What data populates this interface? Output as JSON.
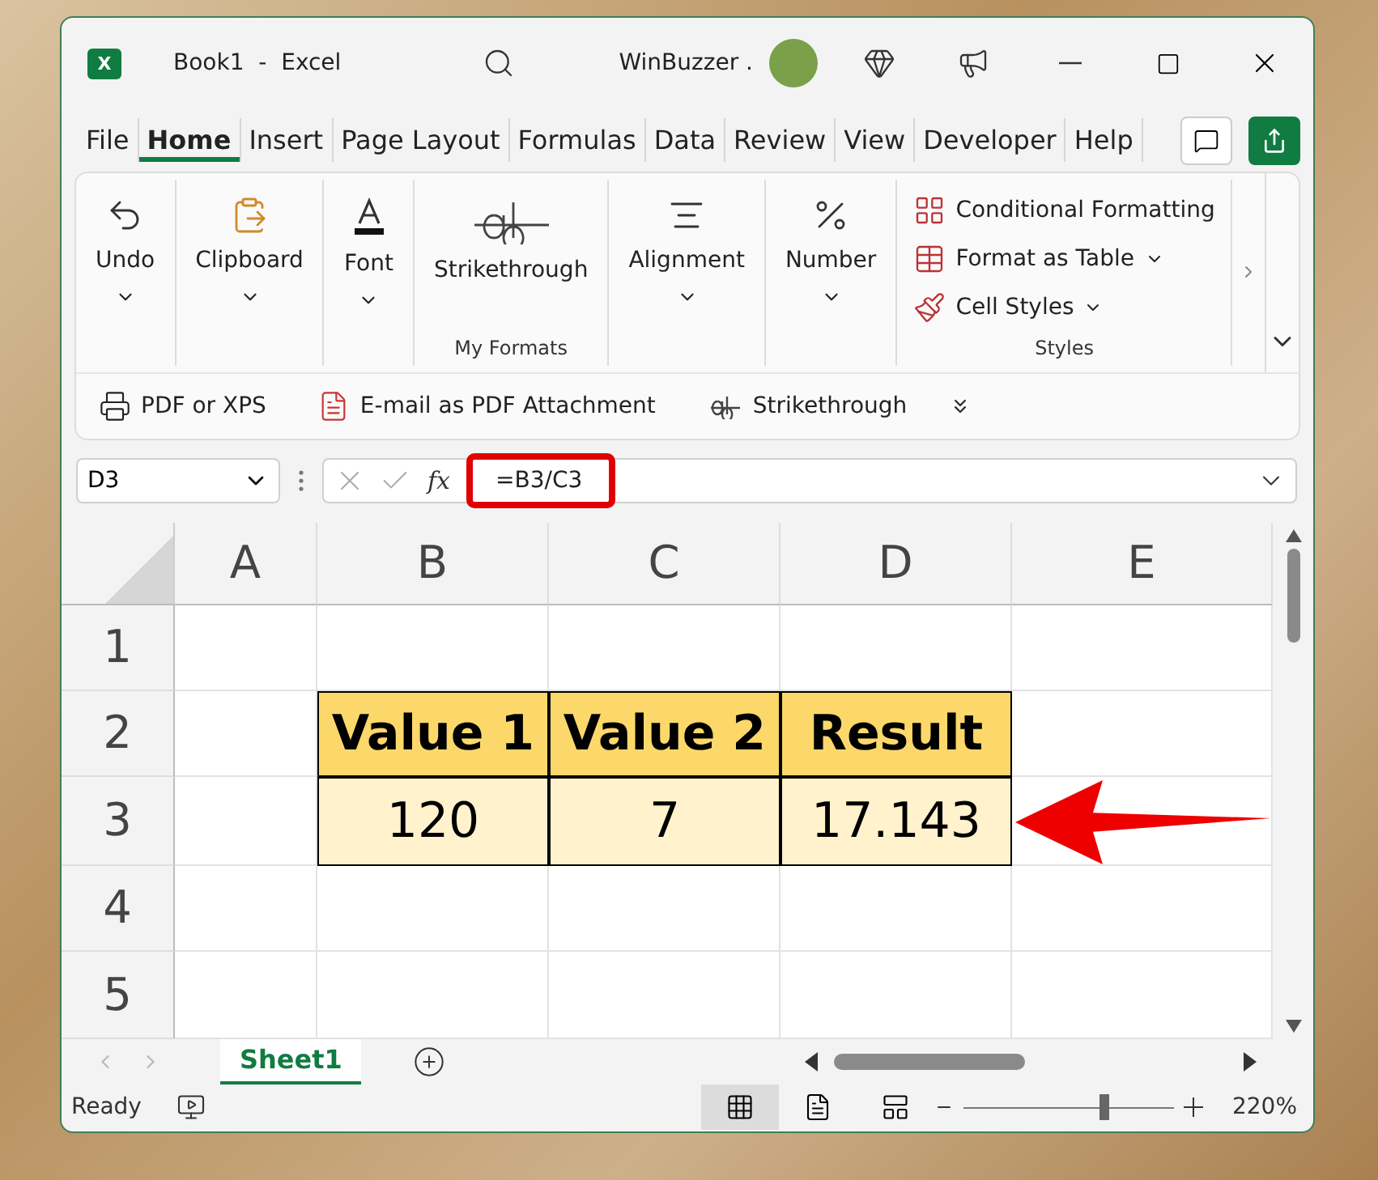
{
  "window": {
    "app_icon": "X",
    "document": "Book1",
    "separator": "-",
    "app_name": "Excel",
    "account": "WinBuzzer ."
  },
  "menu_tabs": [
    {
      "label": "File",
      "selected": false
    },
    {
      "label": "Home",
      "selected": true
    },
    {
      "label": "Insert",
      "selected": false
    },
    {
      "label": "Page Layout",
      "selected": false
    },
    {
      "label": "Formulas",
      "selected": false
    },
    {
      "label": "Data",
      "selected": false
    },
    {
      "label": "Review",
      "selected": false
    },
    {
      "label": "View",
      "selected": false
    },
    {
      "label": "Developer",
      "selected": false
    },
    {
      "label": "Help",
      "selected": false
    }
  ],
  "ribbon": {
    "groups": [
      {
        "kind": "large",
        "items": [
          {
            "label": "Undo",
            "dropdown": true
          }
        ]
      },
      {
        "kind": "large",
        "items": [
          {
            "label": "Clipboard",
            "dropdown": true
          }
        ]
      },
      {
        "kind": "large",
        "items": [
          {
            "label": "Font",
            "dropdown": true
          }
        ]
      },
      {
        "kind": "large",
        "name": "My Formats",
        "items": [
          {
            "label": "Strikethrough",
            "dropdown": false
          }
        ]
      },
      {
        "kind": "large",
        "items": [
          {
            "label": "Alignment",
            "dropdown": true
          }
        ]
      },
      {
        "kind": "large",
        "items": [
          {
            "label": "Number",
            "dropdown": true
          }
        ]
      },
      {
        "kind": "list",
        "name": "Styles",
        "items": [
          {
            "label": "Conditional Formatting",
            "dropdown": false
          },
          {
            "label": "Format as Table",
            "dropdown": true
          },
          {
            "label": "Cell Styles",
            "dropdown": true
          }
        ]
      }
    ]
  },
  "quick_access": [
    {
      "label": "PDF or XPS"
    },
    {
      "label": "E-mail as PDF Attachment"
    },
    {
      "label": "Strikethrough"
    }
  ],
  "formula_bar": {
    "name_box": "D3",
    "function_label": "fx",
    "formula": "=B3/C3",
    "highlighted": true
  },
  "sheet": {
    "columns": [
      "A",
      "B",
      "C",
      "D",
      "E"
    ],
    "rows": [
      {
        "header": "1"
      },
      {
        "header": "2",
        "kind": "header",
        "cells": {
          "B": "Value 1",
          "C": "Value 2",
          "D": "Result"
        }
      },
      {
        "header": "3",
        "kind": "data",
        "cells": {
          "B": "120",
          "C": "7",
          "D": "17.143"
        }
      },
      {
        "header": "4"
      },
      {
        "header": "5"
      }
    ]
  },
  "sheet_tabs": [
    {
      "label": "Sheet1",
      "selected": true
    }
  ],
  "status_bar": {
    "text": "Ready",
    "views": [
      {
        "selected": true
      },
      {
        "selected": false
      },
      {
        "selected": false
      }
    ],
    "zoom_slider": {
      "level": 0.67
    },
    "zoom": "220%"
  }
}
